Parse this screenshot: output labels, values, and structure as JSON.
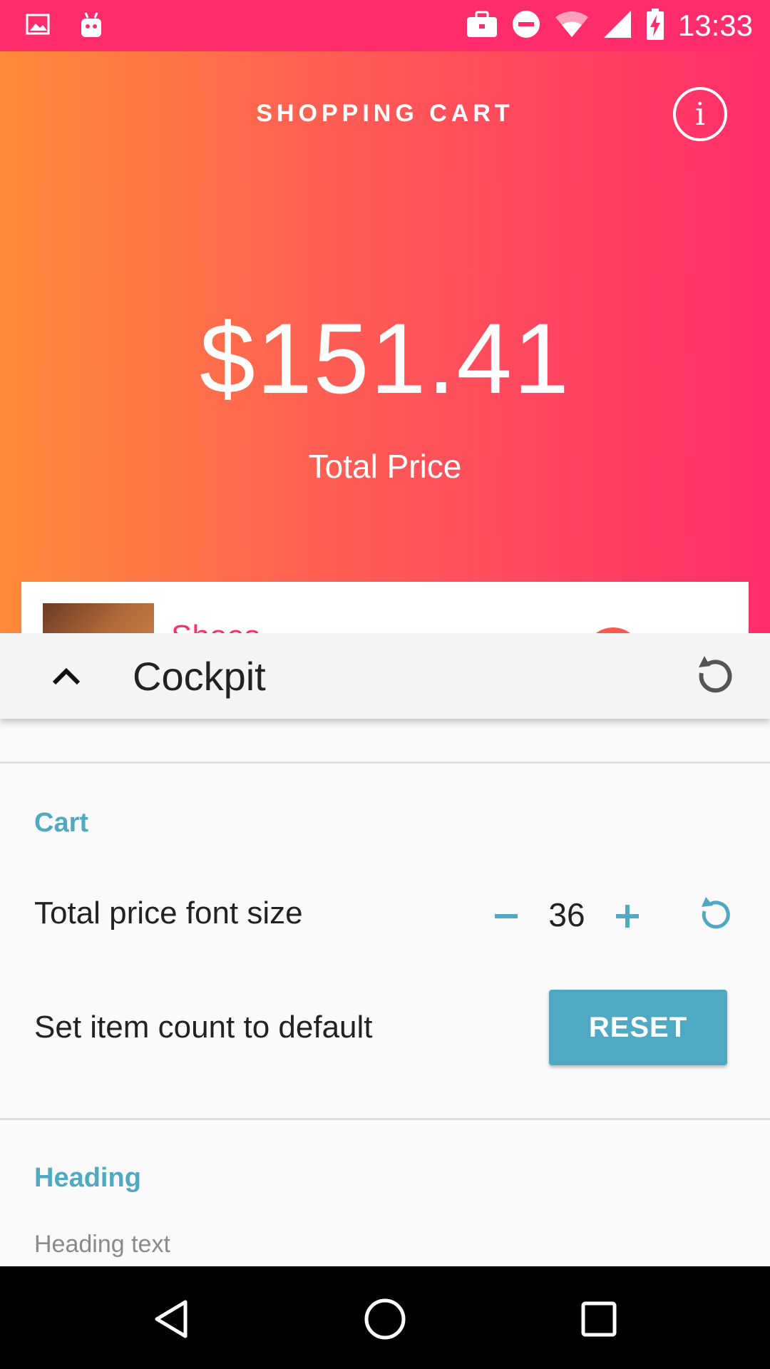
{
  "status_bar": {
    "time": "13:33",
    "icons_left": [
      "image-icon",
      "android-icon"
    ],
    "icons_right": [
      "briefcase-icon",
      "do-not-disturb-icon",
      "wifi-icon",
      "signal-icon",
      "battery-charging-icon"
    ]
  },
  "header": {
    "title": "SHOPPING CART",
    "info_icon": "info-icon",
    "total_price": "$151.41",
    "total_label": "Total Price"
  },
  "cart": {
    "first_item_name": "Shoes"
  },
  "cockpit": {
    "title": "Cockpit",
    "sections": [
      {
        "title": "Cart",
        "font_size_label": "Total price font size",
        "font_size_value": "36",
        "item_count_label": "Set item count to default",
        "reset_label": "RESET"
      },
      {
        "title": "Heading",
        "heading_text_label": "Heading text"
      }
    ]
  },
  "colors": {
    "status_bar": "#ff2d6b",
    "gradient_start": "#ff8a3a",
    "gradient_end": "#ff2d6b",
    "accent": "#4fa9c2",
    "nav_bar": "#000000"
  }
}
